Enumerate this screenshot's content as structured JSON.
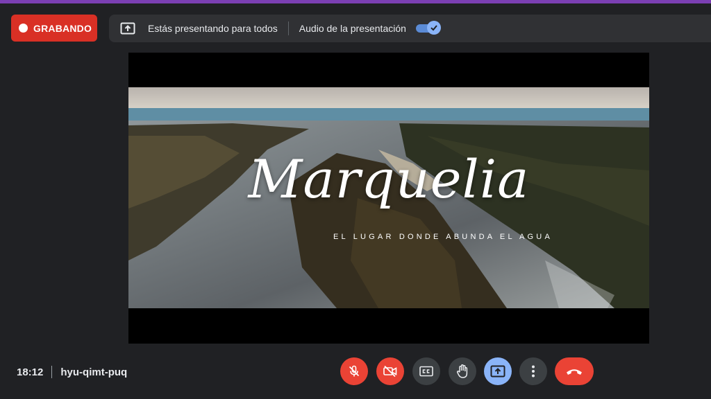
{
  "recording": {
    "label": "GRABANDO"
  },
  "presenting": {
    "status_text": "Estás presentando para todos",
    "audio_label": "Audio de la presentación",
    "audio_enabled": true
  },
  "video": {
    "title": "Marquelia",
    "subtitle": "EL LUGAR DONDE ABUNDA EL AGUA"
  },
  "meeting": {
    "time": "18:12",
    "code": "hyu-qimt-puq"
  },
  "controls": [
    {
      "name": "mic-off-button",
      "icon": "mic-off-icon",
      "state": "off",
      "color": "#ea4335"
    },
    {
      "name": "camera-off-button",
      "icon": "camera-off-icon",
      "state": "off",
      "color": "#ea4335"
    },
    {
      "name": "captions-button",
      "icon": "captions-icon",
      "state": "off",
      "color": "#3c4043"
    },
    {
      "name": "raise-hand-button",
      "icon": "hand-icon",
      "state": "off",
      "color": "#3c4043"
    },
    {
      "name": "present-button",
      "icon": "present-screen-icon",
      "state": "active",
      "color": "#8ab4f8"
    },
    {
      "name": "more-options-button",
      "icon": "more-vert-icon",
      "state": "normal",
      "color": "#3c4043"
    },
    {
      "name": "leave-call-button",
      "icon": "phone-hangup-icon",
      "state": "normal",
      "color": "#ea4335"
    }
  ],
  "colors": {
    "background": "#202124",
    "recording": "#d93025",
    "accent": "#8ab4f8",
    "top_accent": "#7b3fb3"
  }
}
